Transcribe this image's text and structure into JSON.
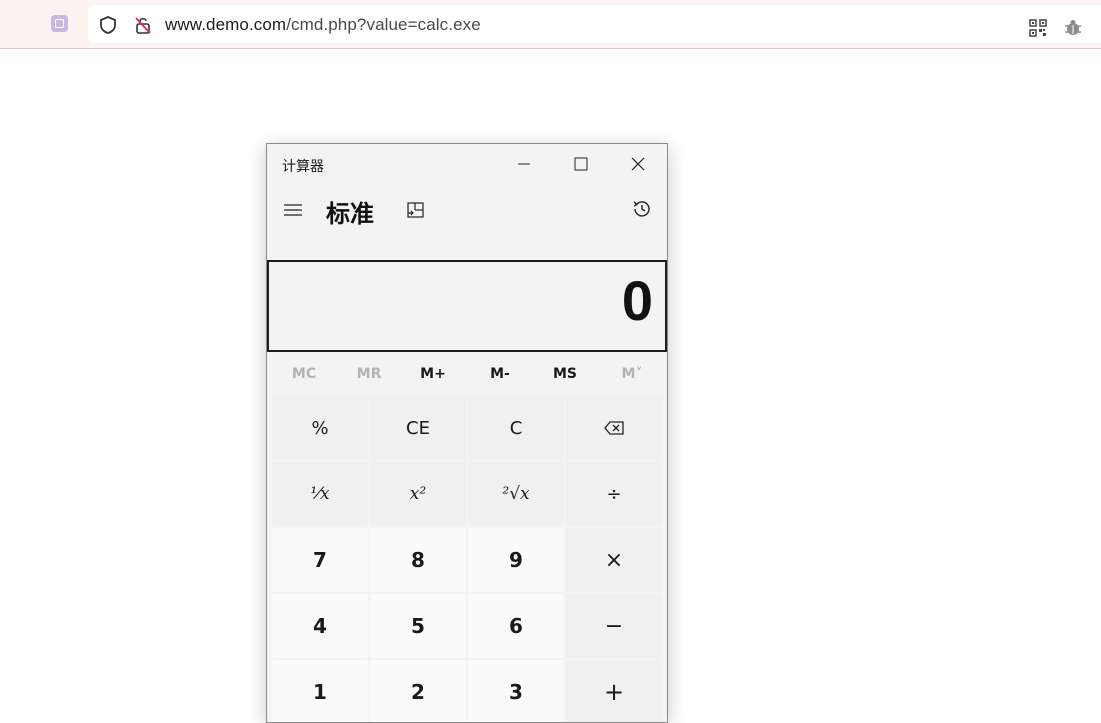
{
  "browser": {
    "url_host": "www.demo.com",
    "url_path": "/cmd.php?value=calc.exe",
    "icons": [
      "extension-icon",
      "shield-icon",
      "insecure-lock-icon",
      "qr-code-icon",
      "bug-icon"
    ]
  },
  "calculator": {
    "title": "计算器",
    "mode": "标准",
    "display": "0",
    "memory": [
      {
        "label": "MC",
        "enabled": false
      },
      {
        "label": "MR",
        "enabled": false
      },
      {
        "label": "M+",
        "enabled": true
      },
      {
        "label": "M-",
        "enabled": true
      },
      {
        "label": "MS",
        "enabled": true
      },
      {
        "label": "M˅",
        "enabled": false
      }
    ],
    "keys": {
      "percent": "%",
      "ce": "CE",
      "c": "C",
      "backspace": "⌫",
      "reciprocal": "⅟x",
      "square": "x²",
      "sqrt": "²√x",
      "divide": "÷",
      "n7": "7",
      "n8": "8",
      "n9": "9",
      "multiply": "×",
      "n4": "4",
      "n5": "5",
      "n6": "6",
      "minus": "−",
      "n1": "1",
      "n2": "2",
      "n3": "3",
      "plus": "+"
    }
  }
}
